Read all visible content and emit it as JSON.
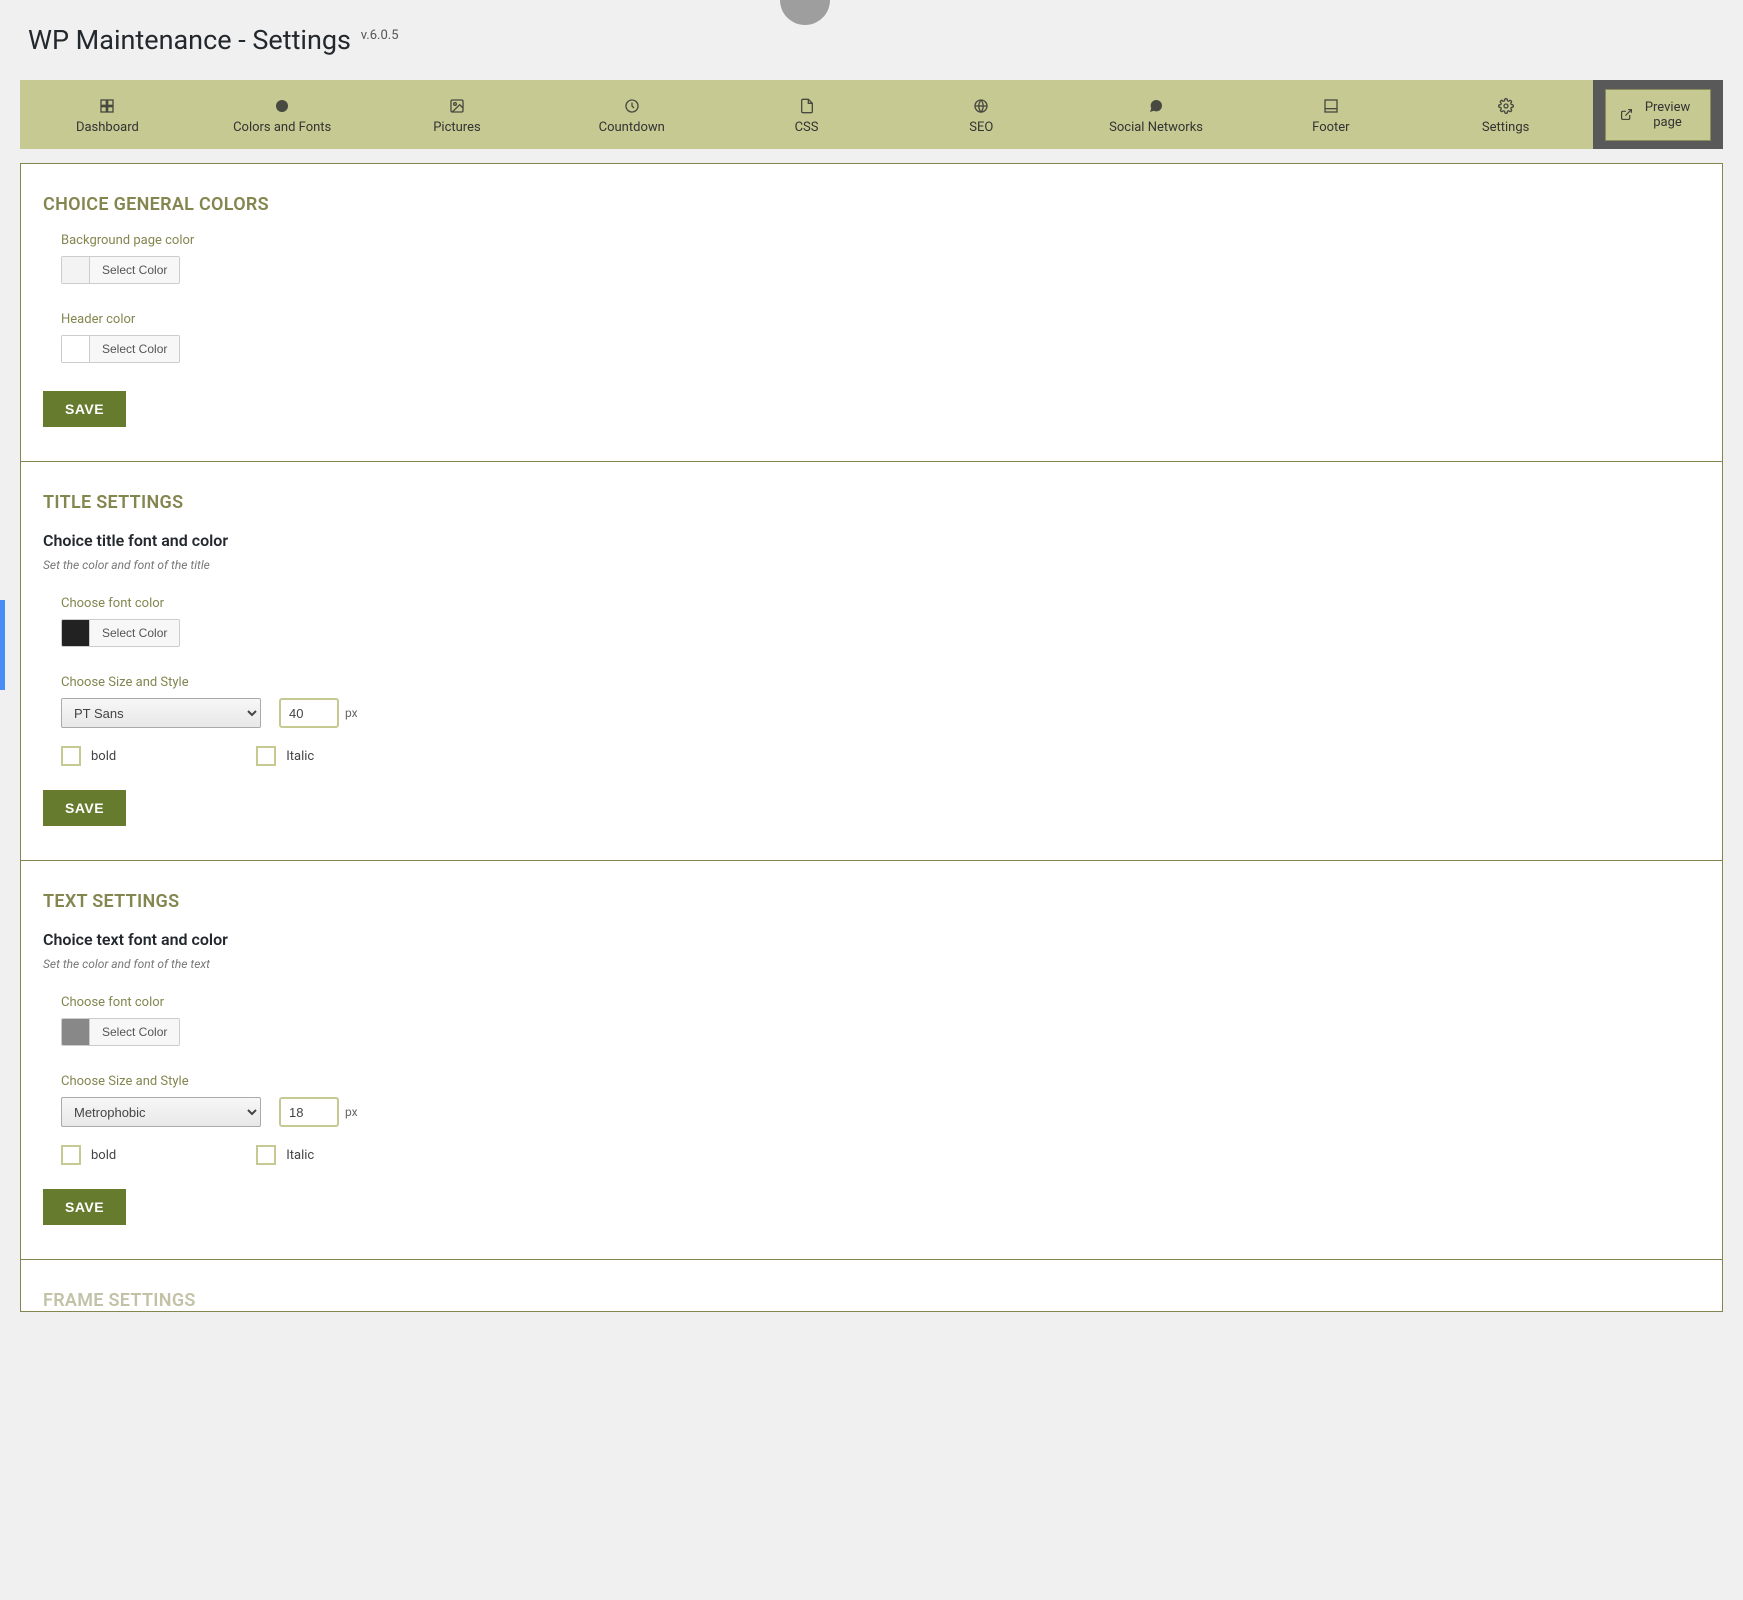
{
  "header": {
    "title": "WP Maintenance - Settings",
    "version": "v.6.0.5"
  },
  "tabs": [
    {
      "id": "dashboard",
      "label": "Dashboard",
      "icon": "dashboard"
    },
    {
      "id": "colors-fonts",
      "label": "Colors and Fonts",
      "icon": "palette"
    },
    {
      "id": "pictures",
      "label": "Pictures",
      "icon": "image"
    },
    {
      "id": "countdown",
      "label": "Countdown",
      "icon": "clock"
    },
    {
      "id": "css",
      "label": "CSS",
      "icon": "file"
    },
    {
      "id": "seo",
      "label": "SEO",
      "icon": "globe"
    },
    {
      "id": "social",
      "label": "Social Networks",
      "icon": "chat"
    },
    {
      "id": "footer",
      "label": "Footer",
      "icon": "footer"
    },
    {
      "id": "settings",
      "label": "Settings",
      "icon": "gear"
    }
  ],
  "preview": {
    "label": "Preview page"
  },
  "section1": {
    "heading": "CHOICE GENERAL COLORS",
    "bg_label": "Background page color",
    "header_label": "Header color",
    "select_color": "Select Color",
    "save": "SAVE"
  },
  "section2": {
    "heading": "TITLE SETTINGS",
    "sub": "Choice title font and color",
    "desc": "Set the color and font of the title",
    "font_color_label": "Choose font color",
    "select_color": "Select Color",
    "size_style_label": "Choose Size and Style",
    "font_value": "PT Sans",
    "size_value": "40",
    "px": "px",
    "bold": "bold",
    "italic": "Italic",
    "save": "SAVE"
  },
  "section3": {
    "heading": "TEXT SETTINGS",
    "sub": "Choice text font and color",
    "desc": "Set the color and font of the text",
    "font_color_label": "Choose font color",
    "select_color": "Select Color",
    "size_style_label": "Choose Size and Style",
    "font_value": "Metrophobic",
    "size_value": "18",
    "px": "px",
    "bold": "bold",
    "italic": "Italic",
    "save": "SAVE"
  },
  "section4": {
    "heading": "FRAME SETTINGS"
  }
}
